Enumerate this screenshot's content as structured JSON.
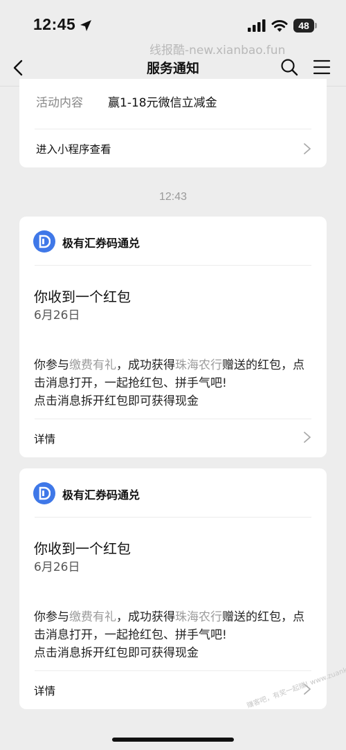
{
  "status_bar": {
    "time": "12:45",
    "battery": "48"
  },
  "watermark_top": "线报酷-new.xianbao.fun",
  "nav": {
    "title": "服务通知"
  },
  "top_card": {
    "activity_label": "活动内容",
    "activity_value": "赢1-18元微信立减金",
    "link_label": "进入小程序查看"
  },
  "timestamp": "12:43",
  "messages": [
    {
      "brand": "极有汇券码通兑",
      "title": "你收到一个红包",
      "date": "6月26日",
      "body_pre": "你参与",
      "body_hl1": "缴费有礼",
      "body_mid": "，成功获得",
      "body_hl2": "珠海农行",
      "body_post": "赠送的红包，点击消息打开，一起抢红包、拼手气吧!",
      "body_line3": "点击消息拆开红包即可获得现金",
      "detail_label": "详情"
    },
    {
      "brand": "极有汇券码通兑",
      "title": "你收到一个红包",
      "date": "6月26日",
      "body_pre": "你参与",
      "body_hl1": "缴费有礼",
      "body_mid": "，成功获得",
      "body_hl2": "珠海农行",
      "body_post": "赠送的红包，点击消息打开，一起抢红包、拼手气吧!",
      "body_line3": "点击消息拆开红包即可获得现金",
      "detail_label": "详情"
    }
  ],
  "watermark_corner": "赚客吧，有奖一起赚! www.zuanke8.com",
  "colors": {
    "background": "#ededed",
    "card": "#ffffff",
    "brand_blue": "#3f78e8",
    "highlight_gray": "#9b9b9b"
  },
  "icons": [
    "location-arrow-icon",
    "signal-icon",
    "wifi-icon",
    "back-icon",
    "search-icon",
    "menu-icon",
    "chevron-right-icon",
    "brand-logo-icon"
  ]
}
